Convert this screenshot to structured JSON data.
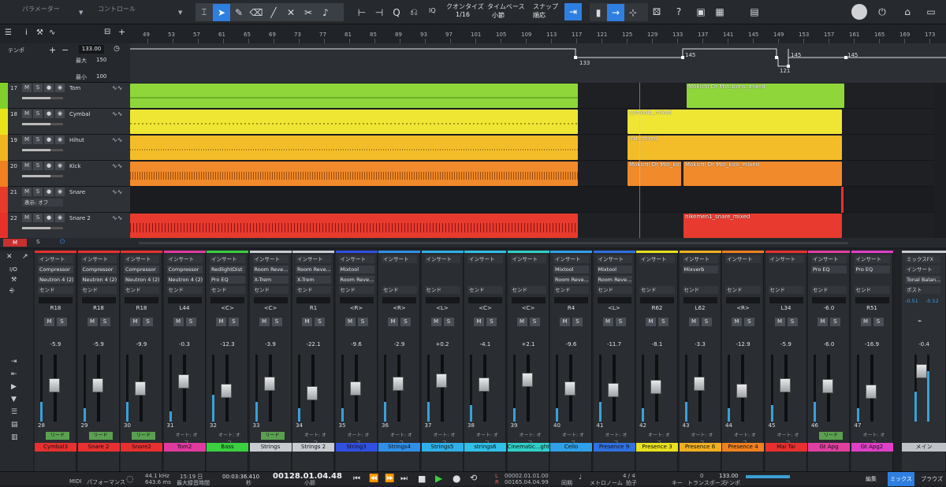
{
  "toolbar": {
    "parameter_label": "パラメーター",
    "control_label": "コントロール",
    "quantize_label": "クオンタイズ",
    "quantize_value": "1/16",
    "timebase_label": "タイムベース",
    "timebase_value": "小節",
    "snap_label": "スナップ",
    "snap_value": "順応",
    "iq_label": "IQ"
  },
  "ruler": {
    "marks": [
      "49",
      "53",
      "57",
      "61",
      "65",
      "69",
      "73",
      "77",
      "81",
      "85",
      "89",
      "93",
      "97",
      "101",
      "105",
      "109",
      "113",
      "117",
      "121",
      "125",
      "129",
      "133",
      "137",
      "141",
      "145",
      "149",
      "153",
      "157",
      "161",
      "165",
      "169",
      "173"
    ]
  },
  "tempo": {
    "label": "テンポ",
    "value": "133.00",
    "max_label": "最大",
    "max_value": "150",
    "min_label": "最小",
    "min_value": "100",
    "points": [
      "133",
      "145",
      "145",
      "145",
      "121"
    ]
  },
  "tracks": [
    {
      "num": "17",
      "name": "Tom",
      "color": "#7fd12a"
    },
    {
      "num": "18",
      "name": "Cymbal",
      "color": "#e9e31a"
    },
    {
      "num": "19",
      "name": "Hihut",
      "color": "#f0b41e"
    },
    {
      "num": "20",
      "name": "Kick",
      "color": "#f08020"
    },
    {
      "num": "21",
      "name": "Snare",
      "color": "#e83a2a",
      "sub": "表示: オフ"
    },
    {
      "num": "22",
      "name": "Snare 2",
      "color": "#e8302a"
    }
  ],
  "clips": {
    "tom_mixed": "Mokichi Dr Mst_toms_mixed",
    "cymbals_mixed": "cymbals_mixed",
    "hat_mixed": "hat_mixed",
    "kick_a": "Mokichi Dr Mst_kick",
    "kick_b": "Mokichi Dr Mst_kick_mixed",
    "snare_mixed": "nikemen1_snare_mixed"
  },
  "mixer": {
    "insert_label": "インサート",
    "send_label": "センド",
    "ready_label": "リード",
    "auto_off": "オート: オフ",
    "io_label": "I/O",
    "mixfx_label": "ミックスFX",
    "post_label": "ポスト",
    "main_name": "メイン",
    "main_db": "-0.4",
    "main_slot": "Tonal Balan...",
    "main_meter": [
      "-0.51",
      "-0.52"
    ],
    "channels": [
      {
        "num": "28",
        "name": "Cymbal3",
        "pan": "R18",
        "db": "-5.9",
        "color": "#e83030",
        "slots": [
          "Compressor",
          "Neutron 4 (2)"
        ],
        "ready": true,
        "level": 0.55,
        "meter": 0.3
      },
      {
        "num": "29",
        "name": "Snare 2",
        "pan": "R18",
        "db": "-5.9",
        "color": "#e83030",
        "slots": [
          "Compressor",
          "Neutron 4 (2)"
        ],
        "ready": true,
        "level": 0.55,
        "meter": 0.2
      },
      {
        "num": "30",
        "name": "Snare2",
        "pan": "R18",
        "db": "-9.9",
        "color": "#e83030",
        "slots": [
          "Compressor",
          "Neutron 4 (2)"
        ],
        "ready": true,
        "level": 0.5,
        "meter": 0.3
      },
      {
        "num": "31",
        "name": "Tom2",
        "pan": "L44",
        "db": "-0.3",
        "color": "#e03aa0",
        "slots": [
          "Compressor",
          "Neutron 4 (2)"
        ],
        "ready": false,
        "level": 0.62,
        "meter": 0.15
      },
      {
        "num": "32",
        "name": "Bass",
        "pan": "<C>",
        "db": "-12.3",
        "color": "#3ad040",
        "slots": [
          "RedlightDist",
          "Pro EQ"
        ],
        "ready": false,
        "level": 0.45,
        "meter": 0.4
      },
      {
        "num": "33",
        "name": "Strings",
        "pan": "<C>",
        "db": "-3.9",
        "color": "#c8ccd2",
        "slots": [
          "Room Reve...",
          "X-Trem"
        ],
        "ready": true,
        "level": 0.58,
        "meter": 0.3
      },
      {
        "num": "34",
        "name": "Strings 2",
        "pan": "R1",
        "db": "-22.1",
        "color": "#c8ccd2",
        "slots": [
          "Room Reve...",
          "X-Trem"
        ],
        "ready": false,
        "level": 0.4,
        "meter": 0.2
      },
      {
        "num": "35",
        "name": "String3",
        "pan": "<R>",
        "db": "-9.6",
        "color": "#3050e0",
        "slots": [
          "Mixtool",
          "Room Reve..."
        ],
        "ready": false,
        "level": 0.5,
        "meter": 0.2
      },
      {
        "num": "36",
        "name": "Strings4",
        "pan": "<R>",
        "db": "-2.9",
        "color": "#3090e8",
        "slots": [],
        "ready": false,
        "level": 0.58,
        "meter": 0.3
      },
      {
        "num": "37",
        "name": "Strings5",
        "pan": "<L>",
        "db": "+0.2",
        "color": "#30b0e8",
        "slots": [],
        "ready": false,
        "level": 0.64,
        "meter": 0.3
      },
      {
        "num": "38",
        "name": "strings6",
        "pan": "<C>",
        "db": "-4.1",
        "color": "#30c0e8",
        "slots": [],
        "ready": false,
        "level": 0.56,
        "meter": 0.25
      },
      {
        "num": "39",
        "name": "Cinematic...ghts",
        "pan": "<C>",
        "db": "+2.1",
        "color": "#30d0c8",
        "slots": [],
        "ready": false,
        "level": 0.66,
        "meter": 0.2
      },
      {
        "num": "40",
        "name": "Cello",
        "pan": "R4",
        "db": "-9.6",
        "color": "#30a0e8",
        "slots": [
          "Mixtool",
          "Room Reve..."
        ],
        "ready": false,
        "level": 0.5,
        "meter": 0.2
      },
      {
        "num": "41",
        "name": "Presence 9",
        "pan": "<L>",
        "db": "-11.7",
        "color": "#3070e0",
        "slots": [
          "Mixtool",
          "Room Reve..."
        ],
        "ready": false,
        "level": 0.47,
        "meter": 0.3
      },
      {
        "num": "42",
        "name": "Presence 3",
        "pan": "R62",
        "db": "-8.1",
        "color": "#e8e020",
        "slots": [],
        "ready": false,
        "level": 0.52,
        "meter": 0.2
      },
      {
        "num": "43",
        "name": "Presence 6",
        "pan": "L62",
        "db": "-3.3",
        "color": "#f0b020",
        "slots": [
          "Mixverb"
        ],
        "ready": false,
        "level": 0.58,
        "meter": 0.3
      },
      {
        "num": "44",
        "name": "Presence 4",
        "pan": "<R>",
        "db": "-12.9",
        "color": "#f08020",
        "slots": [],
        "ready": false,
        "level": 0.45,
        "meter": 0.2
      },
      {
        "num": "45",
        "name": "Mai Tai",
        "pan": "L34",
        "db": "-5.9",
        "color": "#e83030",
        "slots": [],
        "ready": false,
        "level": 0.55,
        "meter": 0.25
      },
      {
        "num": "46",
        "name": "Gt Apg",
        "pan": "-6.0",
        "db": "-6.0",
        "color": "#e040a0",
        "slots": [
          "Pro EQ"
        ],
        "ready": true,
        "level": 0.54,
        "meter": 0.3
      },
      {
        "num": "47",
        "name": "Gt Apg2",
        "pan": "R51",
        "db": "-16.9",
        "color": "#e040c8",
        "slots": [
          "Pro EQ"
        ],
        "ready": false,
        "level": 0.43,
        "meter": 0.2
      }
    ]
  },
  "transport": {
    "midi": "MIDI",
    "performance": "パフォーマンス",
    "sample_rate": "44.1 kHz",
    "latency": "643.6 ms",
    "rec_time": "15:19 日",
    "rec_max": "最大録音時間",
    "time": "00:03:36.410",
    "time_unit": "秒",
    "position": "00128.01.04.48",
    "position_unit": "小節",
    "loop_l": "00002.01.01.00",
    "loop_r": "00165.04.04.99",
    "sync": "同期",
    "metronome": "メトロノーム",
    "signature": "4 / 4",
    "signature_label": "拍子",
    "key_label": "キー",
    "transpose": "0",
    "transpose_label": "トランスポーズ",
    "tempo": "133.00",
    "tempo_label": "テンポ",
    "edit_tab": "編集",
    "mix_tab": "ミックス",
    "browse_tab": "ブラウズ"
  }
}
